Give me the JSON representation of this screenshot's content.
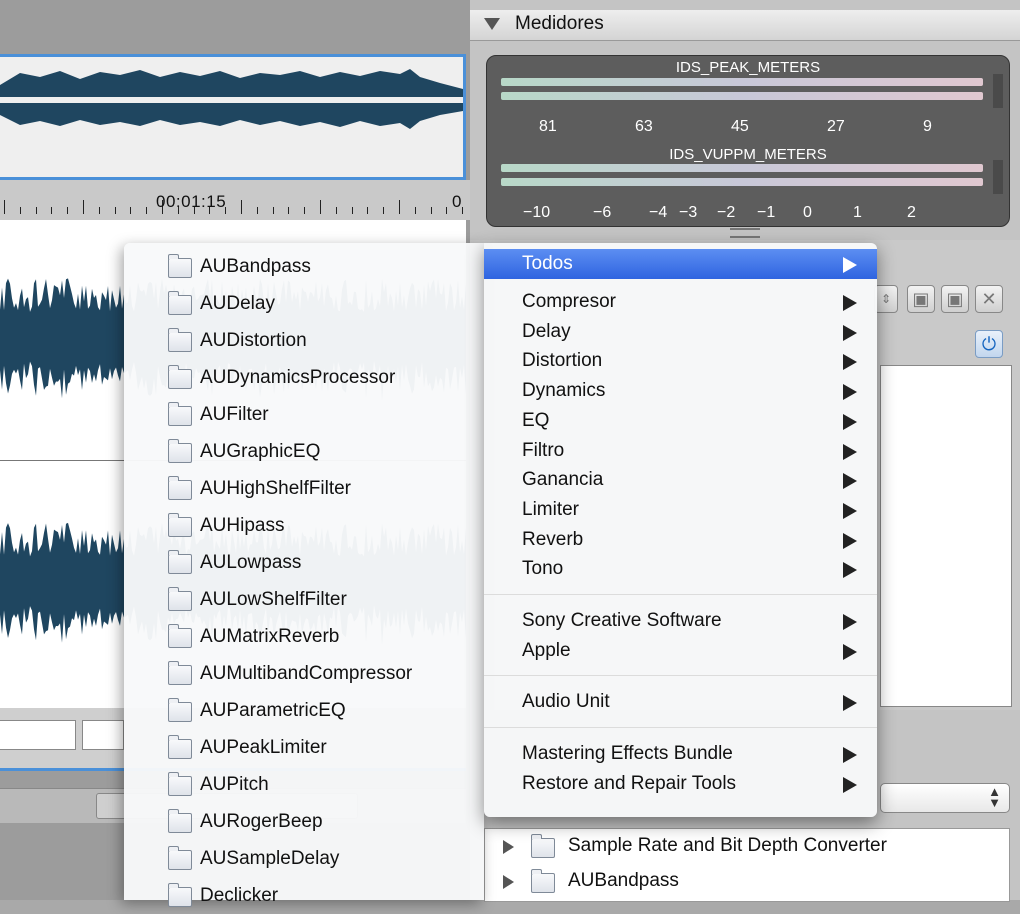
{
  "meters": {
    "title": "Medidores",
    "peak_label": "IDS_PEAK_METERS",
    "peak_scale": [
      "81",
      "63",
      "45",
      "27",
      "9"
    ],
    "vu_label": "IDS_VUPPM_METERS",
    "vu_scale": [
      "−10",
      "−6",
      "−4",
      "−3",
      "−2",
      "−1",
      "0",
      "1",
      "2"
    ]
  },
  "editor": {
    "time_label": "00:01:15",
    "ruler_edge": "0"
  },
  "toolbar": {
    "save_icon": "save-icon",
    "save_as_icon": "save-as-icon",
    "close_icon": "close-icon",
    "power_icon": "power-icon"
  },
  "menu": {
    "selected": "Todos",
    "groups": [
      [
        "Compresor",
        "Delay",
        "Distortion",
        "Dynamics",
        "EQ",
        "Filtro",
        "Ganancia",
        "Limiter",
        "Reverb",
        "Tono"
      ],
      [
        "Sony Creative Software",
        "Apple"
      ],
      [
        "Audio Unit"
      ],
      [
        "Mastering Effects Bundle",
        "Restore and Repair Tools"
      ]
    ]
  },
  "submenu": {
    "items": [
      "AUBandpass",
      "AUDelay",
      "AUDistortion",
      "AUDynamicsProcessor",
      "AUFilter",
      "AUGraphicEQ",
      "AUHighShelfFilter",
      "AUHipass",
      "AULowpass",
      "AULowShelfFilter",
      "AUMatrixReverb",
      "AUMultibandCompressor",
      "AUParametricEQ",
      "AUPeakLimiter",
      "AUPitch",
      "AURogerBeep",
      "AUSampleDelay",
      "Declicker"
    ]
  },
  "chain": {
    "items": [
      "Sample Rate and Bit Depth Converter",
      "AUBandpass"
    ]
  },
  "colors": {
    "accent": "#4a90d9",
    "waveform": "#1f4660",
    "menu_highlight": "#2f64e0"
  }
}
